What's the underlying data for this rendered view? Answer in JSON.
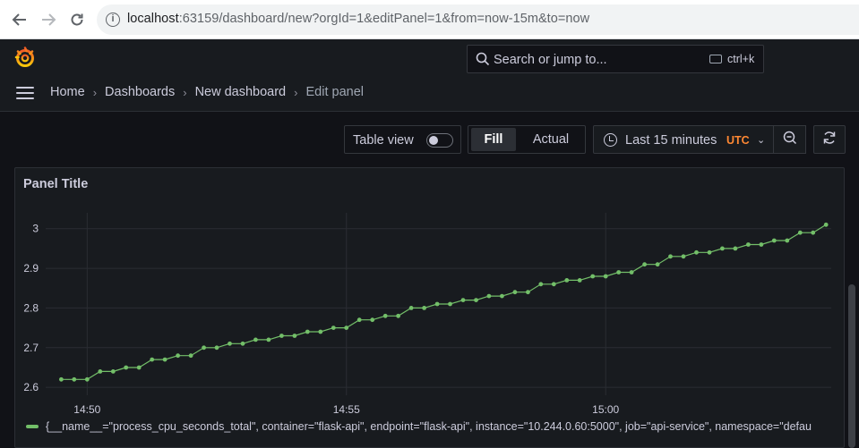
{
  "browser": {
    "url_host": "localhost",
    "url_rest": ":63159/dashboard/new?orgId=1&editPanel=1&from=now-15m&to=now"
  },
  "topbar": {
    "search_placeholder": "Search or jump to...",
    "search_shortcut": "ctrl+k"
  },
  "breadcrumb": {
    "items": [
      "Home",
      "Dashboards",
      "New dashboard",
      "Edit panel"
    ]
  },
  "toolbar": {
    "table_view_label": "Table view",
    "table_view_on": false,
    "fill_label": "Fill",
    "actual_label": "Actual",
    "time_range_label": "Last 15 minutes",
    "timezone_label": "UTC"
  },
  "panel": {
    "title": "Panel Title",
    "legend_text": "{__name__=\"process_cpu_seconds_total\", container=\"flask-api\", endpoint=\"flask-api\", instance=\"10.244.0.60:5000\", job=\"api-service\", namespace=\"defau",
    "series_color": "#73bf69"
  },
  "chart_data": {
    "type": "line",
    "x_ticks": [
      "14:50",
      "14:55",
      "15:00"
    ],
    "x_tick_minutes": [
      0,
      5,
      10
    ],
    "xlim_minutes": [
      -0.5,
      14.25
    ],
    "y_ticks": [
      2.6,
      2.7,
      2.8,
      2.9,
      3
    ],
    "y_tick_labels": [
      "2.6",
      "2.7",
      "2.8",
      "2.9",
      "3"
    ],
    "ylim": [
      2.58,
      3.04
    ],
    "series": [
      {
        "x_minutes": [
          -0.5,
          -0.25,
          0,
          0.25,
          0.5,
          0.75,
          1,
          1.25,
          1.5,
          1.75,
          2,
          2.25,
          2.5,
          2.75,
          3,
          3.25,
          3.5,
          3.75,
          4,
          4.25,
          4.5,
          4.75,
          5,
          5.25,
          5.5,
          5.75,
          6,
          6.25,
          6.5,
          6.75,
          7,
          7.25,
          7.5,
          7.75,
          8,
          8.25,
          8.5,
          8.75,
          9,
          9.25,
          9.5,
          9.75,
          10,
          10.25,
          10.5,
          10.75,
          11,
          11.25,
          11.5,
          11.75,
          12,
          12.25,
          12.5,
          12.75,
          13,
          13.25,
          13.5,
          13.75,
          14,
          14.25
        ],
        "values": [
          2.62,
          2.62,
          2.62,
          2.64,
          2.64,
          2.65,
          2.65,
          2.67,
          2.67,
          2.68,
          2.68,
          2.7,
          2.7,
          2.71,
          2.71,
          2.72,
          2.72,
          2.73,
          2.73,
          2.74,
          2.74,
          2.75,
          2.75,
          2.77,
          2.77,
          2.78,
          2.78,
          2.8,
          2.8,
          2.81,
          2.81,
          2.82,
          2.82,
          2.83,
          2.83,
          2.84,
          2.84,
          2.86,
          2.86,
          2.87,
          2.87,
          2.88,
          2.88,
          2.89,
          2.89,
          2.91,
          2.91,
          2.93,
          2.93,
          2.94,
          2.94,
          2.95,
          2.95,
          2.96,
          2.96,
          2.97,
          2.97,
          2.99,
          2.99,
          3.01
        ]
      }
    ],
    "grid": true,
    "legend_position": "bottom"
  }
}
